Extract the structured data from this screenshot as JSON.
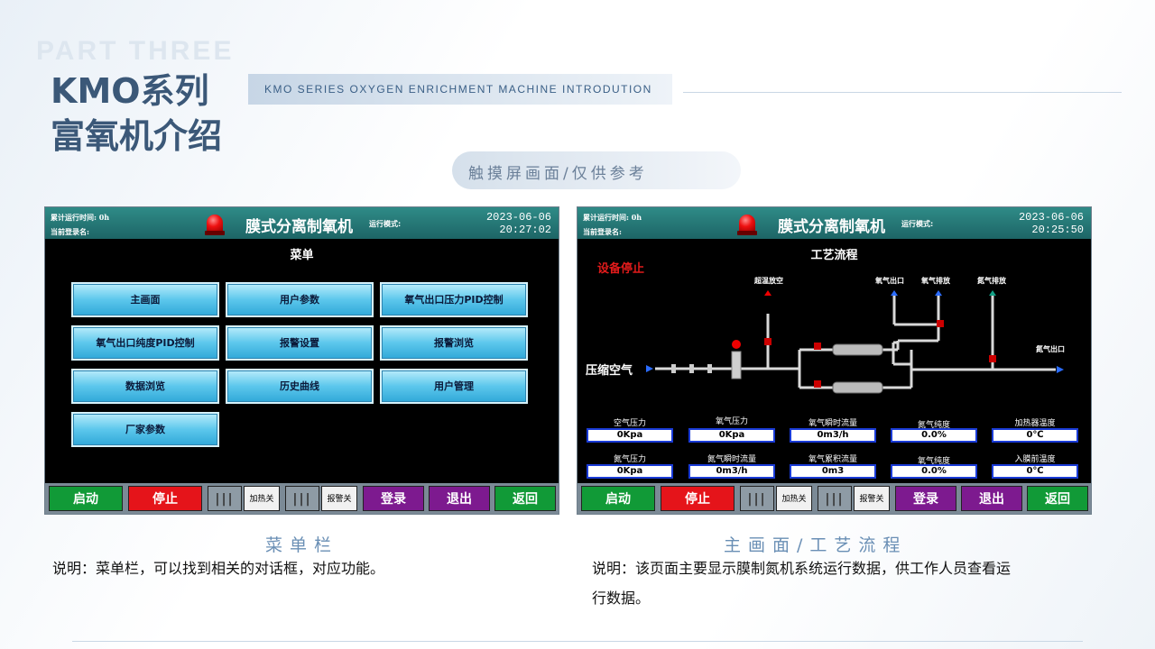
{
  "slide": {
    "part_bg": "PART THREE",
    "title_line1": "KMO系列",
    "title_line2": "富氧机介绍",
    "subtitle": "KMO SERIES OXYGEN ENRICHMENT MACHINE INTRODUTION",
    "pill": "触摸屏画面/仅供参考"
  },
  "left_screen": {
    "run_time": "累计运行时间: 0h",
    "login_user": "当前登录名:",
    "title": "膜式分离制氧机",
    "mode": "运行模式:",
    "date": "2023-06-06",
    "time": "20:27:02",
    "subtitle": "菜单",
    "menu": [
      "主画面",
      "用户参数",
      "氧气出口压力PID控制",
      "氧气出口纯度PID控制",
      "报警设置",
      "报警浏览",
      "数据浏览",
      "历史曲线",
      "用户管理",
      "厂家参数"
    ]
  },
  "right_screen": {
    "run_time": "累计运行时间: 0h",
    "login_user": "当前登录名:",
    "title": "膜式分离制氧机",
    "mode": "运行模式:",
    "date": "2023-06-06",
    "time": "20:25:50",
    "subtitle": "工艺流程",
    "status": "设备停止",
    "labels": {
      "overtemp": "超温放空",
      "o2_out": "氧气出口",
      "o2_vent": "氧气排放",
      "n2_vent": "氮气排放",
      "n2_out": "氮气出口",
      "air": "压缩空气"
    },
    "data_row1": [
      {
        "label": "空气压力",
        "value": "0Kpa"
      },
      {
        "label": "氧气压力",
        "value": "0Kpa"
      },
      {
        "label": "氧气瞬时流量",
        "value": "0m3/h"
      },
      {
        "label": "氮气纯度",
        "value": "0.0%"
      },
      {
        "label": "加热器温度",
        "value": "0℃"
      }
    ],
    "data_row2": [
      {
        "label": "氮气压力",
        "value": "0Kpa"
      },
      {
        "label": "氮气瞬时流量",
        "value": "0m3/h"
      },
      {
        "label": "氧气累积流量",
        "value": "0m3"
      },
      {
        "label": "氧气纯度",
        "value": "0.0%"
      },
      {
        "label": "入膜前温度",
        "value": "0℃"
      }
    ]
  },
  "bottom_bar": {
    "start": "启动",
    "stop": "停止",
    "grip": "|||",
    "heat": "加热关",
    "alarm": "报警关",
    "login": "登录",
    "logout": "退出",
    "back": "返回"
  },
  "captions": {
    "left": "菜单栏",
    "right": "主画面/工艺流程",
    "left_desc": "说明：菜单栏，可以找到相关的对话框，对应功能。",
    "right_desc_1": "说明：该页面主要显示膜制氮机系统运行数据，供工作人员查看运",
    "right_desc_2": "行数据。"
  },
  "colors": {
    "header_teal": "#2f8b87",
    "menu_button": "#5cc7ec",
    "start_green": "#119a37",
    "stop_red": "#e5141a",
    "purple": "#7d1a8f",
    "title_blue": "#3b5878"
  }
}
